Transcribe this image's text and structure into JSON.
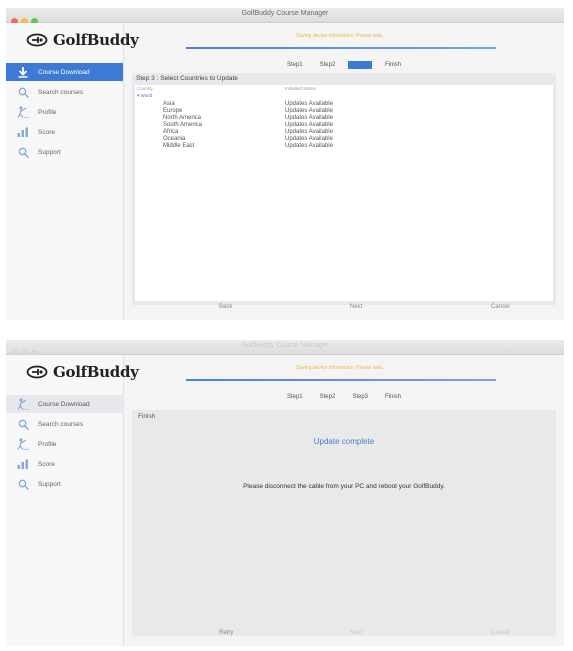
{
  "app": {
    "logo_text": "GolfBuddy",
    "colors": {
      "accent": "#3c7ad6",
      "banner": "#e8b84a",
      "complete_text": "#4a7fc4"
    }
  },
  "windows": [
    {
      "title": "GolfBuddy Course Manager",
      "banner": "Saving device information. Please wait...",
      "sidebar": [
        {
          "label": "Course Download",
          "icon": "download-arrow-icon"
        },
        {
          "label": "Search courses",
          "icon": "magnifier-icon"
        },
        {
          "label": "Profile",
          "icon": "golfer-icon"
        },
        {
          "label": "Score",
          "icon": "bar-chart-icon"
        },
        {
          "label": "Support",
          "icon": "magnifier-icon"
        }
      ],
      "steps": [
        "Step1",
        "Step2",
        "Step3",
        "Finish"
      ],
      "panel": {
        "heading": "Step 3 : Select Countries to Update",
        "col1": "Country",
        "col2": "Installed Status",
        "root": "▾ World",
        "rows": [
          {
            "country": "Asia",
            "status": "Updates Available"
          },
          {
            "country": "Europe",
            "status": "Updates Available"
          },
          {
            "country": "North America",
            "status": "Updates Available"
          },
          {
            "country": "South America",
            "status": "Updates Available"
          },
          {
            "country": "Africa",
            "status": "Updates Available"
          },
          {
            "country": "Oceania",
            "status": "Updates Available"
          },
          {
            "country": "Middle East",
            "status": "Updates Available"
          }
        ]
      },
      "buttons": {
        "back": "Back",
        "next": "Next",
        "cancel": "Cancel"
      }
    },
    {
      "title": "GolfBuddy Course Manager",
      "banner": "Saving device information. Please wait...",
      "sidebar": [
        {
          "label": "Course Download",
          "icon": "golfer-icon"
        },
        {
          "label": "Search courses",
          "icon": "magnifier-icon"
        },
        {
          "label": "Profile",
          "icon": "golfer-icon"
        },
        {
          "label": "Score",
          "icon": "bar-chart-icon"
        },
        {
          "label": "Support",
          "icon": "magnifier-icon"
        }
      ],
      "steps": [
        "Step1",
        "Step2",
        "Step3",
        "Finish"
      ],
      "panel": {
        "heading": "Finish",
        "complete": "Update complete",
        "message": "Please disconnect the cable from your PC and reboot your GolfBuddy."
      },
      "buttons": {
        "retry": "Retry",
        "next": "Next",
        "cancel": "Cancel"
      }
    }
  ]
}
